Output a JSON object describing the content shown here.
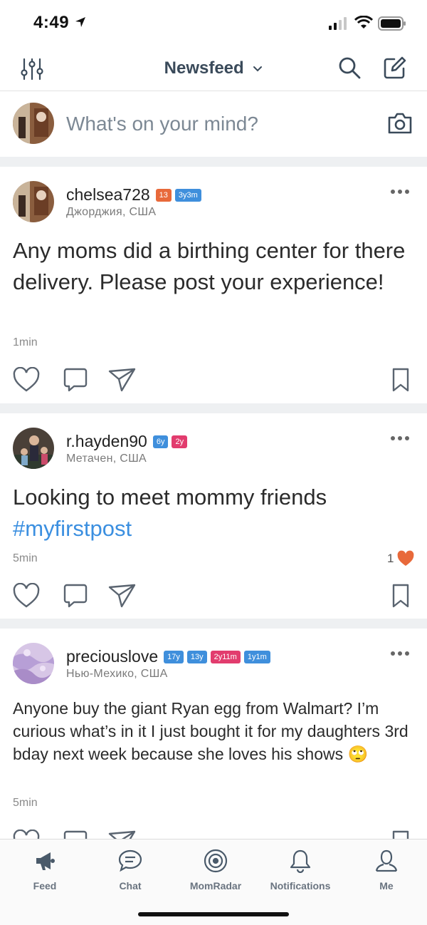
{
  "status_bar": {
    "time": "4:49"
  },
  "header": {
    "title": "Newsfeed"
  },
  "composer": {
    "placeholder": "What's on your mind?"
  },
  "posts": [
    {
      "username": "chelsea728",
      "badges": [
        {
          "text": "13",
          "color": "#e8693a"
        },
        {
          "text": "3y3m",
          "color": "#3f8fdc"
        }
      ],
      "location": "Джорджия, США",
      "text": "Any moms did a birthing center for there delivery. Please post your experience!",
      "time": "1min"
    },
    {
      "username": "r.hayden90",
      "badges": [
        {
          "text": "6y",
          "color": "#3f8fdc"
        },
        {
          "text": "2y",
          "color": "#e23c6e"
        }
      ],
      "location": "Метачен, США",
      "text": "Looking to meet mommy friends",
      "hashtag": "#myfirstpost",
      "time": "5min",
      "likes": "1"
    },
    {
      "username": "preciouslove",
      "badges": [
        {
          "text": "17y",
          "color": "#3f8fdc"
        },
        {
          "text": "13y",
          "color": "#3f8fdc"
        },
        {
          "text": "2y11m",
          "color": "#e23c6e"
        },
        {
          "text": "1y1m",
          "color": "#3f8fdc"
        }
      ],
      "location": "Нью-Мехико, США",
      "text": "Anyone buy the giant Ryan egg from Walmart? I’m curious what’s in it I just bought it for my daughters 3rd bday next week because she loves his shows",
      "emoji": "🙄",
      "time": "5min"
    }
  ],
  "tabs": [
    {
      "label": "Feed",
      "icon": "megaphone-icon"
    },
    {
      "label": "Chat",
      "icon": "chat-bubble-icon"
    },
    {
      "label": "MomRadar",
      "icon": "radar-icon"
    },
    {
      "label": "Notifications",
      "icon": "bell-icon"
    },
    {
      "label": "Me",
      "icon": "person-icon"
    }
  ],
  "colors": {
    "accent": "#3b8fe0",
    "like": "#e8693a",
    "nav_text": "#3a4a5a"
  }
}
